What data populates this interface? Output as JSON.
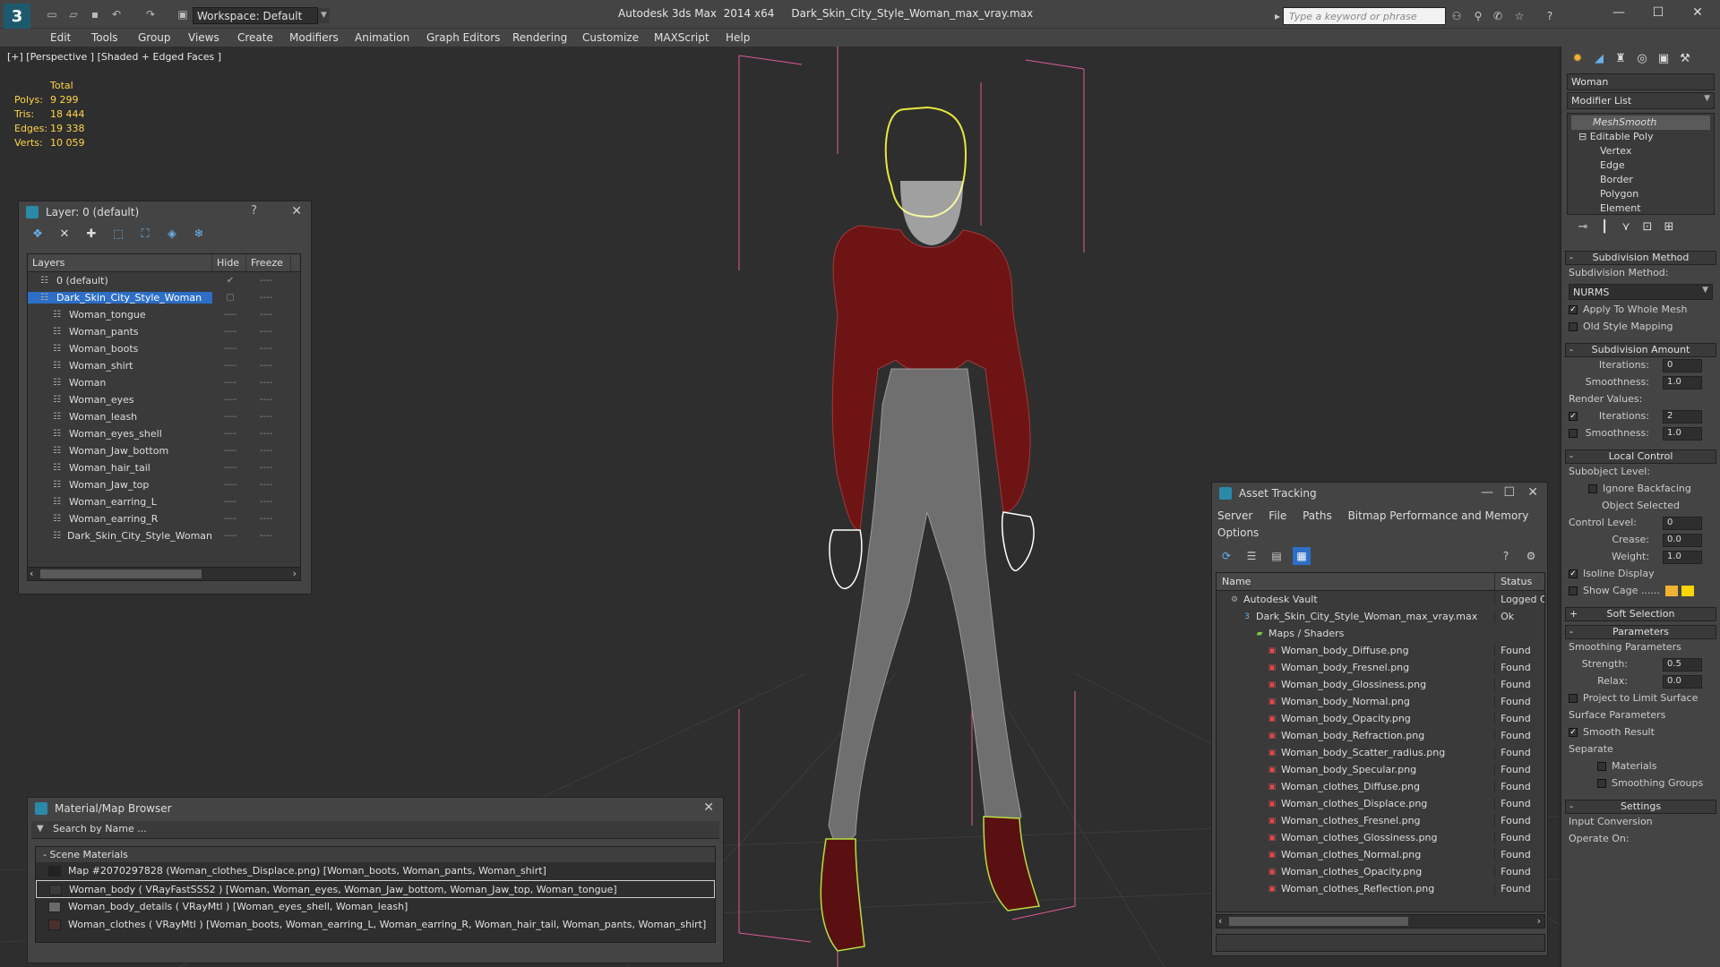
{
  "app": {
    "logo": "3",
    "title": "Autodesk 3ds Max  2014 x64     Dark_Skin_City_Style_Woman_max_vray.max",
    "workspace": "Workspace: Default",
    "search_placeholder": "Type a keyword or phrase"
  },
  "menu": [
    "Edit",
    "Tools",
    "Group",
    "Views",
    "Create",
    "Modifiers",
    "Animation",
    "Graph Editors",
    "Rendering",
    "Customize",
    "MAXScript",
    "Help"
  ],
  "viewport": {
    "label": "[+] [Perspective ] [Shaded + Edged Faces ]",
    "stats": {
      "total_label": "Total",
      "rows": [
        {
          "k": "Polys:",
          "v": "9 299"
        },
        {
          "k": "Tris:",
          "v": "18 444"
        },
        {
          "k": "Edges:",
          "v": "19 338"
        },
        {
          "k": "Verts:",
          "v": "10 059"
        }
      ]
    }
  },
  "layer_panel": {
    "title": "Layer: 0 (default)",
    "help": "?",
    "columns": {
      "layers": "Layers",
      "hide": "Hide",
      "freeze": "Freeze"
    },
    "rows": [
      {
        "name": "0 (default)",
        "indent": 1,
        "hide": "✔",
        "freeze": "----"
      },
      {
        "name": "Dark_Skin_City_Style_Woman",
        "indent": 1,
        "selected": true,
        "hide": "▢",
        "freeze": "----"
      },
      {
        "name": "Woman_tongue",
        "indent": 2,
        "hide": "----",
        "freeze": "----"
      },
      {
        "name": "Woman_pants",
        "indent": 2,
        "hide": "----",
        "freeze": "----"
      },
      {
        "name": "Woman_boots",
        "indent": 2,
        "hide": "----",
        "freeze": "----"
      },
      {
        "name": "Woman_shirt",
        "indent": 2,
        "hide": "----",
        "freeze": "----"
      },
      {
        "name": "Woman",
        "indent": 2,
        "hide": "----",
        "freeze": "----"
      },
      {
        "name": "Woman_eyes",
        "indent": 2,
        "hide": "----",
        "freeze": "----"
      },
      {
        "name": "Woman_leash",
        "indent": 2,
        "hide": "----",
        "freeze": "----"
      },
      {
        "name": "Woman_eyes_shell",
        "indent": 2,
        "hide": "----",
        "freeze": "----"
      },
      {
        "name": "Woman_Jaw_bottom",
        "indent": 2,
        "hide": "----",
        "freeze": "----"
      },
      {
        "name": "Woman_hair_tail",
        "indent": 2,
        "hide": "----",
        "freeze": "----"
      },
      {
        "name": "Woman_Jaw_top",
        "indent": 2,
        "hide": "----",
        "freeze": "----"
      },
      {
        "name": "Woman_earring_L",
        "indent": 2,
        "hide": "----",
        "freeze": "----"
      },
      {
        "name": "Woman_earring_R",
        "indent": 2,
        "hide": "----",
        "freeze": "----"
      },
      {
        "name": "Dark_Skin_City_Style_Woman",
        "indent": 2,
        "hide": "----",
        "freeze": "----"
      }
    ]
  },
  "material_browser": {
    "title": "Material/Map Browser",
    "search": "Search by Name ...",
    "group": "- Scene Materials",
    "rows": [
      {
        "text": "Map #2070297828 (Woman_clothes_Displace.png)  [Woman_boots, Woman_pants, Woman_shirt]",
        "swatch": "#222222"
      },
      {
        "text": "Woman_body  ( VRayFastSSS2 )  [Woman, Woman_eyes, Woman_Jaw_bottom, Woman_Jaw_top, Woman_tongue]",
        "swatch": "#3a3a3a",
        "selected": true
      },
      {
        "text": "Woman_body_details  ( VRayMtl )  [Woman_eyes_shell, Woman_leash]",
        "swatch": "#6a6a6a"
      },
      {
        "text": "Woman_clothes  ( VRayMtl )  [Woman_boots, Woman_earring_L, Woman_earring_R, Woman_hair_tail, Woman_pants, Woman_shirt]",
        "swatch": "#4a3030"
      }
    ]
  },
  "asset_tracking": {
    "title": "Asset Tracking",
    "menu": [
      "Server",
      "File",
      "Paths",
      "Bitmap Performance and Memory",
      "Options"
    ],
    "columns": {
      "name": "Name",
      "status": "Status"
    },
    "rows": [
      {
        "name": "Autodesk Vault",
        "status": "Logged C",
        "indent": 1,
        "icon": "vault"
      },
      {
        "name": "Dark_Skin_City_Style_Woman_max_vray.max",
        "status": "Ok",
        "indent": 2,
        "icon": "max"
      },
      {
        "name": "Maps / Shaders",
        "status": "",
        "indent": 3,
        "icon": "folder"
      },
      {
        "name": "Woman_body_Diffuse.png",
        "status": "Found",
        "indent": 4,
        "icon": "png"
      },
      {
        "name": "Woman_body_Fresnel.png",
        "status": "Found",
        "indent": 4,
        "icon": "png"
      },
      {
        "name": "Woman_body_Glossiness.png",
        "status": "Found",
        "indent": 4,
        "icon": "png"
      },
      {
        "name": "Woman_body_Normal.png",
        "status": "Found",
        "indent": 4,
        "icon": "png"
      },
      {
        "name": "Woman_body_Opacity.png",
        "status": "Found",
        "indent": 4,
        "icon": "png"
      },
      {
        "name": "Woman_body_Refraction.png",
        "status": "Found",
        "indent": 4,
        "icon": "png"
      },
      {
        "name": "Woman_body_Scatter_radius.png",
        "status": "Found",
        "indent": 4,
        "icon": "png"
      },
      {
        "name": "Woman_body_Specular.png",
        "status": "Found",
        "indent": 4,
        "icon": "png"
      },
      {
        "name": "Woman_clothes_Diffuse.png",
        "status": "Found",
        "indent": 4,
        "icon": "png"
      },
      {
        "name": "Woman_clothes_Displace.png",
        "status": "Found",
        "indent": 4,
        "icon": "png"
      },
      {
        "name": "Woman_clothes_Fresnel.png",
        "status": "Found",
        "indent": 4,
        "icon": "png"
      },
      {
        "name": "Woman_clothes_Glossiness.png",
        "status": "Found",
        "indent": 4,
        "icon": "png"
      },
      {
        "name": "Woman_clothes_Normal.png",
        "status": "Found",
        "indent": 4,
        "icon": "png"
      },
      {
        "name": "Woman_clothes_Opacity.png",
        "status": "Found",
        "indent": 4,
        "icon": "png"
      },
      {
        "name": "Woman_clothes_Reflection.png",
        "status": "Found",
        "indent": 4,
        "icon": "png"
      }
    ]
  },
  "command_panel": {
    "object_name": "Woman",
    "modifier_list": "Modifier List",
    "stack": [
      {
        "label": "MeshSmooth",
        "top": true
      },
      {
        "label": "⊟ Editable Poly"
      },
      {
        "label": "Vertex",
        "sub": true
      },
      {
        "label": "Edge",
        "sub": true
      },
      {
        "label": "Border",
        "sub": true
      },
      {
        "label": "Polygon",
        "sub": true
      },
      {
        "label": "Element",
        "sub": true
      }
    ],
    "rollouts": {
      "subdivision_method": "Subdivision Method",
      "subdivision_method_label": "Subdivision Method:",
      "method_value": "NURMS",
      "apply_whole_mesh": "Apply To Whole Mesh",
      "old_style_mapping": "Old Style Mapping",
      "subdivision_amount": "Subdivision Amount",
      "iterations_label": "Iterations:",
      "iterations_value": "0",
      "smoothness_label": "Smoothness:",
      "smoothness_value": "1.0",
      "render_values": "Render Values:",
      "render_iterations_value": "2",
      "render_smoothness_value": "1.0",
      "local_control": "Local Control",
      "subobject_level": "Subobject Level:",
      "ignore_backfacing": "Ignore Backfacing",
      "object_selected": "Object Selected",
      "control_level": "Control Level:",
      "control_level_value": "0",
      "crease": "Crease:",
      "crease_value": "0.0",
      "weight": "Weight:",
      "weight_value": "1.0",
      "isoline_display": "Isoline Display",
      "show_cage": "Show Cage ......",
      "soft_selection": "Soft Selection",
      "parameters": "Parameters",
      "smoothing_parameters": "Smoothing Parameters",
      "strength": "Strength:",
      "strength_value": "0.5",
      "relax": "Relax:",
      "relax_value": "0.0",
      "project_limit": "Project to Limit Surface",
      "surface_parameters": "Surface Parameters",
      "smooth_result": "Smooth Result",
      "separate": "Separate",
      "materials": "Materials",
      "smoothing_groups": "Smoothing Groups",
      "settings": "Settings",
      "input_conversion": "Input Conversion",
      "operate_on": "Operate On:"
    }
  }
}
